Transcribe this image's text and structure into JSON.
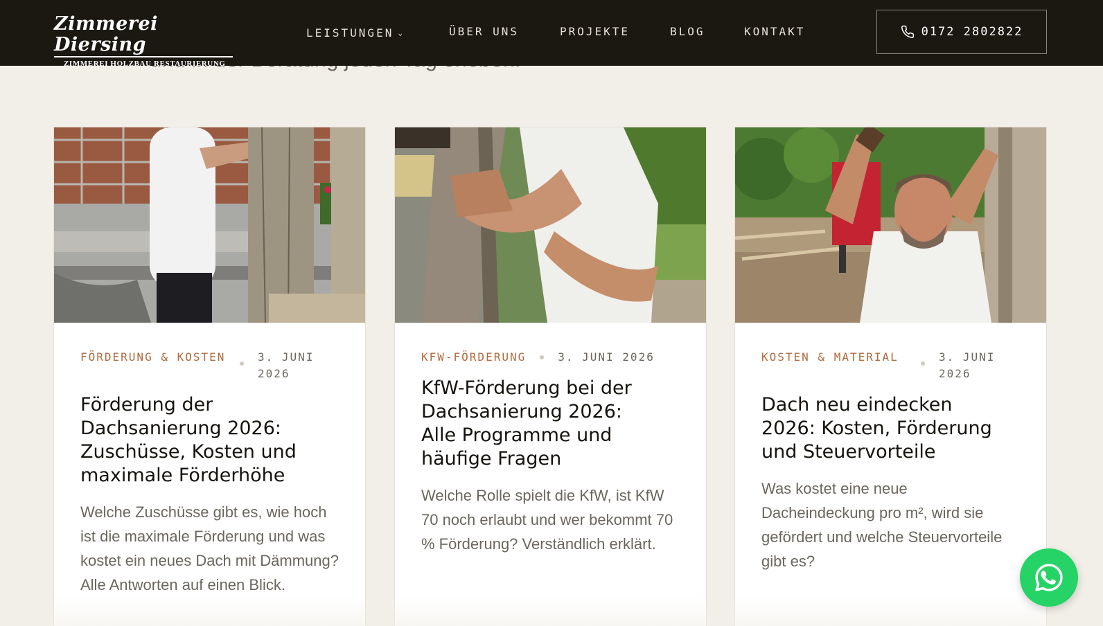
{
  "header": {
    "logo_main": "Zimmerei Diersing",
    "logo_sub": "ZIMMEREI HOLZBAU RESTAURIERUNG",
    "nav": [
      {
        "label": "LEISTUNGEN",
        "has_dropdown": true
      },
      {
        "label": "ÜBER UNS"
      },
      {
        "label": "PROJEKTE"
      },
      {
        "label": "BLOG"
      },
      {
        "label": "KONTAKT"
      }
    ],
    "phone": "0172 2802822"
  },
  "intro_cut_text": "und in der Beratung jeden Tag erleben.",
  "posts": [
    {
      "category": "FÖRDERUNG & KOSTEN",
      "date": "3. JUNI 2026",
      "title": "Förderung der Dachsanierung 2026: Zuschüsse, Kosten und maximale Förderhöhe",
      "excerpt": "Welche Zuschüsse gibt es, wie hoch ist die maximale Förderung und was kostet ein neues Dach mit Dämmung? Alle Antworten auf einen Blick."
    },
    {
      "category": "KFW-FÖRDERUNG",
      "date": "3. JUNI 2026",
      "title": "KfW-Förderung bei der Dachsanierung 2026: Alle Programme und häufige Fragen",
      "excerpt": "Welche Rolle spielt die KfW, ist KfW 70 noch erlaubt und wer bekommt 70 % Förderung? Verständlich erklärt."
    },
    {
      "category": "KOSTEN & MATERIAL",
      "date": "3. JUNI 2026",
      "title": "Dach neu eindecken 2026: Kosten, Förderung und Steuervorteile",
      "excerpt": "Was kostet eine neue Dacheindeckung pro m², wird sie gefördert und welche Steuervorteile gibt es?"
    }
  ],
  "colors": {
    "header_bg": "#1b1812",
    "page_bg": "#f2efe8",
    "category": "#b06a3c",
    "whatsapp": "#25d366"
  }
}
